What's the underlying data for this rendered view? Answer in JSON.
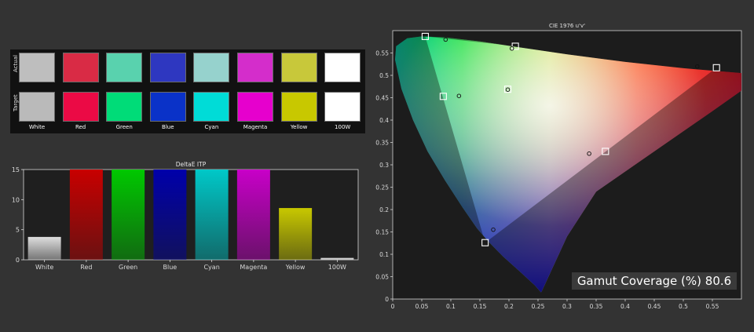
{
  "swatches": {
    "row_labels": [
      "Actual",
      "Target"
    ],
    "items": [
      {
        "name": "White",
        "actual": "#bebebe",
        "target": "#bababa"
      },
      {
        "name": "Red",
        "actual": "#d92b45",
        "target": "#eb0a45"
      },
      {
        "name": "Green",
        "actual": "#59d2ae",
        "target": "#00dc78"
      },
      {
        "name": "Blue",
        "actual": "#2e37c0",
        "target": "#0a32c8"
      },
      {
        "name": "Cyan",
        "actual": "#96d2cd",
        "target": "#00dcd7"
      },
      {
        "name": "Magenta",
        "actual": "#d42dcb",
        "target": "#e600cd"
      },
      {
        "name": "Yellow",
        "actual": "#c8c83a",
        "target": "#c8c800"
      },
      {
        "name": "100W",
        "actual": "#ffffff",
        "target": "#ffffff"
      }
    ]
  },
  "chart_data": [
    {
      "type": "bar",
      "title": "DeltaE ITP",
      "categories": [
        "White",
        "Red",
        "Green",
        "Blue",
        "Cyan",
        "Magenta",
        "Yellow",
        "100W"
      ],
      "values": [
        3.8,
        15,
        15,
        15,
        15,
        15,
        8.6,
        0.3
      ],
      "colors": [
        "#dedede",
        "#c80000",
        "#00c800",
        "#0000aa",
        "#00c8c8",
        "#c800c8",
        "#c8c800",
        "#ffffff"
      ],
      "ylim": [
        0,
        15
      ],
      "yticks": [
        0,
        5,
        10,
        15
      ],
      "grid": false
    },
    {
      "type": "scatter",
      "title": "CIE 1976 u'v'",
      "xlim": [
        0,
        0.6
      ],
      "ylim": [
        0,
        0.6
      ],
      "xticks": [
        0,
        0.05,
        0.1,
        0.15,
        0.2,
        0.25,
        0.3,
        0.35,
        0.4,
        0.45,
        0.5,
        0.55
      ],
      "yticks": [
        0,
        0.05,
        0.1,
        0.15,
        0.2,
        0.25,
        0.3,
        0.35,
        0.4,
        0.45,
        0.5,
        0.55
      ],
      "target_points": [
        {
          "label": "Red",
          "u": 0.557,
          "v": 0.517
        },
        {
          "label": "Green",
          "u": 0.056,
          "v": 0.587
        },
        {
          "label": "Blue",
          "u": 0.159,
          "v": 0.126
        },
        {
          "label": "Cyan",
          "u": 0.087,
          "v": 0.453
        },
        {
          "label": "Magenta",
          "u": 0.366,
          "v": 0.33
        },
        {
          "label": "Yellow",
          "u": 0.211,
          "v": 0.565
        },
        {
          "label": "White",
          "u": 0.198,
          "v": 0.469
        }
      ],
      "measured_points": [
        {
          "label": "Red",
          "u": 0.524,
          "v": 0.52
        },
        {
          "label": "Green",
          "u": 0.091,
          "v": 0.58
        },
        {
          "label": "Blue",
          "u": 0.173,
          "v": 0.155
        },
        {
          "label": "Cyan",
          "u": 0.114,
          "v": 0.454
        },
        {
          "label": "Magenta",
          "u": 0.338,
          "v": 0.325
        },
        {
          "label": "Yellow",
          "u": 0.205,
          "v": 0.56
        },
        {
          "label": "White",
          "u": 0.198,
          "v": 0.468
        }
      ],
      "legend": "none"
    }
  ],
  "gamut": {
    "label": "Gamut Coverage (%)",
    "value": "80.6"
  }
}
